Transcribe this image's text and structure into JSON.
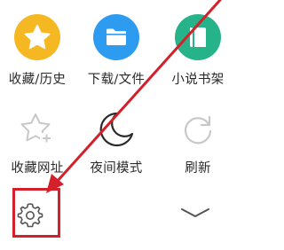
{
  "menu": {
    "items": [
      {
        "label": "收藏/历史",
        "icon": "star-icon",
        "color": "#f5b722"
      },
      {
        "label": "下载/文件",
        "icon": "folder-icon",
        "color": "#2d9bf0"
      },
      {
        "label": "小说书架",
        "icon": "book-icon",
        "color": "#27b389"
      },
      {
        "label": "收藏网址",
        "icon": "star-add-icon",
        "color": "#c8c8c8"
      },
      {
        "label": "夜间模式",
        "icon": "moon-icon",
        "color": "#2a2a2a"
      },
      {
        "label": "刷新",
        "icon": "refresh-icon",
        "color": "#c8c8c8"
      }
    ],
    "settings_icon": "gear-icon",
    "collapse_icon": "chevron-down-icon"
  },
  "annotation": {
    "color": "#d3202a",
    "arrow_icon": "arrow-icon"
  }
}
